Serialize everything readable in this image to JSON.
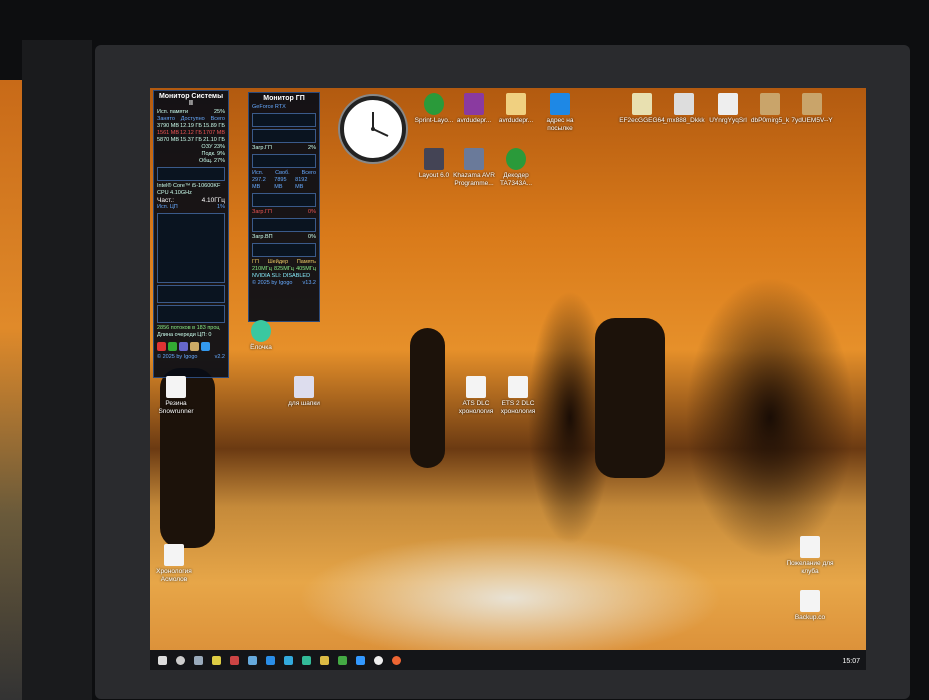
{
  "system_monitor": {
    "title": "Монитор Системы II",
    "mem_label": "Исп. памяти",
    "mem_pct": "25%",
    "mem_headers": [
      "Занято",
      "Доступно",
      "Всего"
    ],
    "mem_rows": [
      [
        "3790 MB",
        "12.19 ГБ",
        "15.89 ГБ"
      ],
      [
        "1561 MB",
        "12.12 ГБ",
        "1707 MB"
      ],
      [
        "5870 MB",
        "15.37 ГБ",
        "21.10 ГБ"
      ]
    ],
    "swap": [
      "ОЗУ 23%",
      "Подк. 9%",
      "Общ. 27%"
    ],
    "cpu_name": "Intel® Core™ i5-10600KF",
    "cpu_freq": "CPU 4.10GHz",
    "freq_label": "Част.:",
    "freq_value": "4.10ГГц",
    "cpu_label": "Исп. ЦП",
    "cpu_pct": "1%",
    "threads": "2856 потоков в 183 проц",
    "queue": "Длина очереди ЦП: 0",
    "footer": "© 2025 by Igogo",
    "version": "v2.2"
  },
  "gpu_monitor": {
    "title": "Монитор ГП",
    "gpu_name": "GeForce RTX",
    "labels": [
      "Загр.ГП",
      "Загр.ГП",
      "Загр.ВП"
    ],
    "pcts": [
      "2%",
      "0%",
      "0%"
    ],
    "vram_headers": [
      "Исп.",
      "Своб.",
      "Всего"
    ],
    "vram_values": [
      "297.2 MB",
      "7895 MB",
      "8192 MB"
    ],
    "clock_headers": [
      "ГП",
      "Шейдер",
      "Память"
    ],
    "clock_values": [
      "210МГц",
      "825МГц",
      "405МГц"
    ],
    "sli": "NVIDIA SLI: DISABLED",
    "footer": "© 2025 by Igogo",
    "version": "v13.2"
  },
  "desktop_icons": [
    {
      "label": "Sprint-Layo...",
      "color": "#2a9a3a"
    },
    {
      "label": "avrdudepr...",
      "color": "#8a3aa0"
    },
    {
      "label": "avrdudepr...",
      "color": "#f0d080"
    },
    {
      "label": "адрес на посылке",
      "color": "#1e88e5"
    },
    {
      "label": "EF2ecGGEG64",
      "color": "#e8e0b0"
    },
    {
      "label": "_mx888_Dkkk",
      "color": "#ddd"
    },
    {
      "label": "UYnrgYyqSrl",
      "color": "#eee"
    },
    {
      "label": "dbP0mirg5_k",
      "color": "#c9a46a"
    },
    {
      "label": "7ydUEM5V--Y",
      "color": "#c9a46a"
    },
    {
      "label": "Layout 6.0",
      "color": "#445"
    },
    {
      "label": "Khazama AVR Programme...",
      "color": "#6a7a9a"
    },
    {
      "label": "Декодер TA7343A...",
      "color": "#2a9a3a"
    },
    {
      "label": "Ёлочка",
      "color": "#3ac8a0"
    },
    {
      "label": "Резина Snowrunner",
      "color": "#f4f4f4"
    },
    {
      "label": "для шапки",
      "color": "#dde"
    },
    {
      "label": "ATS DLC хронология",
      "color": "#f4f4f4"
    },
    {
      "label": "ETS 2 DLC хронология",
      "color": "#f4f4f4"
    },
    {
      "label": "Хронология Асмолов",
      "color": "#f4f4f4"
    },
    {
      "label": "Пожелание для клуба",
      "color": "#f4f4f4"
    },
    {
      "label": "Backup.co",
      "color": "#f4f4f4"
    }
  ],
  "taskbar": {
    "items": [
      "start",
      "search",
      "calculator",
      "explorer",
      "app-red",
      "app",
      "edge",
      "monitor",
      "files",
      "chrome",
      "chrome-alt",
      "maps",
      "app-circle",
      "firefox"
    ],
    "time": "15:07"
  }
}
